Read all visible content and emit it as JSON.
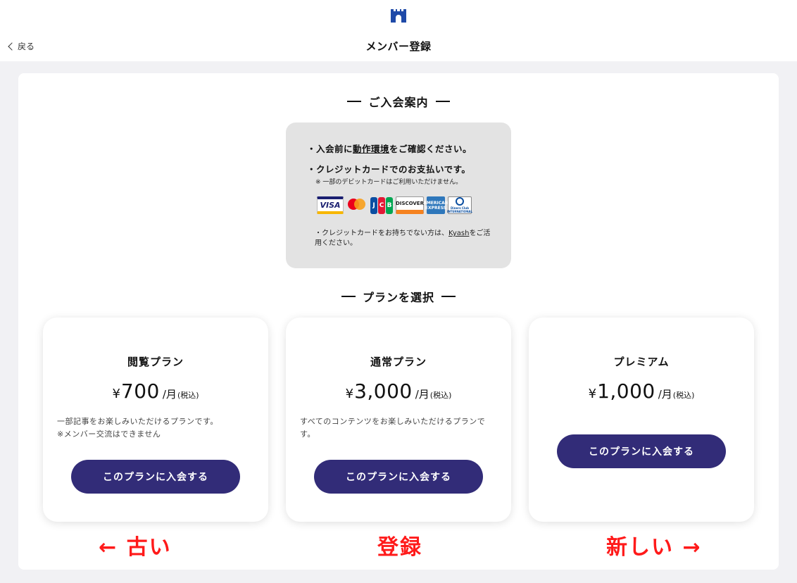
{
  "header": {
    "logo_icon": "castle-icon",
    "back_label": "戻る",
    "title": "メンバー登録"
  },
  "guide": {
    "heading": "ご入会案内",
    "line1_prefix": "・入会前に",
    "line1_link": "動作環境",
    "line1_suffix": "をご確認ください。",
    "line2": "・クレジットカードでのお支払いです。",
    "note": "※ 一部のデビットカードはご利用いただけません。",
    "cards": [
      "VISA",
      "mastercard",
      "JCB",
      "DISCOVER",
      "AMERICAN EXPRESS",
      "Diners Club INTERNATIONAL"
    ],
    "kyash_prefix": "・クレジットカードをお持ちでない方は、",
    "kyash_link": "Kyash",
    "kyash_suffix": "をご活用ください。"
  },
  "plans_section": {
    "heading": "プランを選択",
    "plans": [
      {
        "name": "閲覧プラン",
        "currency": "¥",
        "price": "700",
        "unit": "/月",
        "tax": "(税込)",
        "description": "一部記事をお楽しみいただけるプランです。",
        "description2": "※メンバー交流はできません",
        "button": "このプランに入会する"
      },
      {
        "name": "通常プラン",
        "currency": "¥",
        "price": "3,000",
        "unit": "/月",
        "tax": "(税込)",
        "description": "すべてのコンテンツをお楽しみいただけるプランです。",
        "description2": "",
        "button": "このプランに入会する"
      },
      {
        "name": "プレミアム",
        "currency": "¥",
        "price": "1,000",
        "unit": "/月",
        "tax": "(税込)",
        "description": "",
        "description2": "",
        "button": "このプランに入会する"
      }
    ]
  },
  "annotations": {
    "left": "← 古い",
    "center": "登録",
    "right": "新しい →",
    "color": "#ff1a1a"
  },
  "colors": {
    "brand": "#1f4aa8",
    "button": "#322c78"
  }
}
